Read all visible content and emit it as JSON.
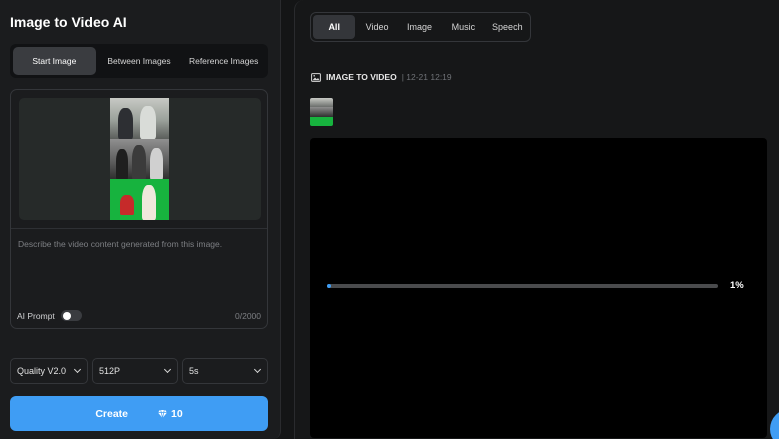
{
  "app": {
    "title": "Image to Video AI"
  },
  "mode_tabs": [
    {
      "label": "Start Image",
      "active": true
    },
    {
      "label": "Between Images",
      "active": false
    },
    {
      "label": "Reference Images",
      "active": false
    }
  ],
  "prompt": {
    "placeholder": "Describe the video content generated from this image.",
    "ai_prompt_label": "AI Prompt",
    "ai_prompt_enabled": false,
    "char_count": "0/2000"
  },
  "settings": {
    "quality": "Quality V2.0",
    "resolution": "512P",
    "duration": "5s"
  },
  "create": {
    "label": "Create",
    "cost": "10",
    "cost_icon": "diamond-icon"
  },
  "filter_tabs": [
    {
      "label": "All",
      "active": true
    },
    {
      "label": "Video",
      "active": false
    },
    {
      "label": "Image",
      "active": false
    },
    {
      "label": "Music",
      "active": false
    },
    {
      "label": "Speech",
      "active": false
    }
  ],
  "job": {
    "type_label": "IMAGE TO VIDEO",
    "timestamp": "| 12-21 12:19",
    "progress_percent": 1,
    "progress_text": "1%"
  },
  "colors": {
    "accent": "#3f9df4",
    "panel": "#1b1c1e",
    "background": "#141516"
  }
}
